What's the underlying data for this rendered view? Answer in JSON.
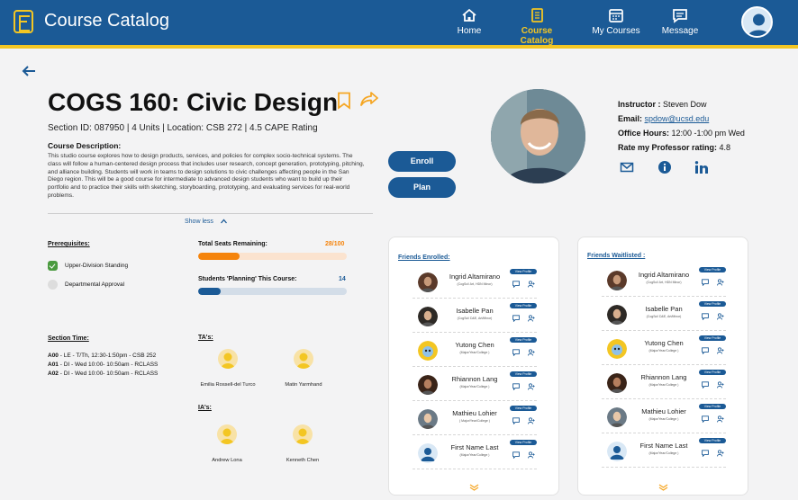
{
  "header": {
    "app_title": "Course Catalog",
    "nav": [
      {
        "label": "Home",
        "icon": "home-icon"
      },
      {
        "label": "Course Catalog",
        "icon": "book-icon",
        "active": true
      },
      {
        "label": "My Courses",
        "icon": "calendar-icon"
      },
      {
        "label": "Message",
        "icon": "message-icon"
      }
    ],
    "colors": {
      "primary": "#1b5a96",
      "accent": "#f3c623",
      "orange": "#f5840c"
    }
  },
  "course": {
    "title": "COGS 160: Civic Design",
    "meta": "Section ID:  087950 | 4 Units | Location: CSB 272 |  4.5 CAPE Rating",
    "description_label": "Course Description:",
    "description": "This studio course explores how to design products, services, and policies for complex socio-technical systems. The class will follow a human-centered design process that includes user research, concept generation, prototyping, pitching, and alliance building. Students will work in teams to design solutions to civic challenges affecting people in the San Diego region. This will be a good course for intermediate to advanced design students who want to build up their portfolio and to practice their skills with sketching, storyboarding, prototyping, and evaluating services for real-world problems.",
    "show_less": "Show less"
  },
  "actions": {
    "enroll": "Enroll",
    "plan": "Plan"
  },
  "instructor": {
    "label": "Instructor :",
    "name": "Steven Dow",
    "email_label": "Email:",
    "email": " spdow@ucsd.edu ",
    "office_label": "Office Hours:",
    "office": "12:00 -1:00 pm Wed",
    "rating_label": "Rate my Professor rating:",
    "rating": "4.8"
  },
  "prerequisites": {
    "label": "Prerequisites:",
    "items": [
      {
        "label": "Upper-Division Standing",
        "met": true
      },
      {
        "label": "Departmental Approval",
        "met": false
      }
    ]
  },
  "seats": {
    "label": "Total Seats Remaining:",
    "count": "28/100",
    "fraction": 0.28,
    "fill_color": "#f5840c",
    "track_color": "#fbe3cf"
  },
  "planning": {
    "label": "Students 'Planning' This Course:",
    "count": "14",
    "fraction": 0.15,
    "fill_color": "#1b5a96",
    "track_color": "#d3dde8"
  },
  "section_time": {
    "label": "Section Time:",
    "rows": [
      {
        "code": "A00",
        "text": " - LE -  T/Th, 12:30-1:50pm - CSB 252"
      },
      {
        "code": "A01",
        "text": " - DI - Wed 10:00- 10:50am - RCLASS"
      },
      {
        "code": "A02",
        "text": " - DI - Wed 10:00- 10:50am - RCLASS"
      }
    ]
  },
  "tas": {
    "label": "TA's:",
    "people": [
      "Emilia Rossell-del Turco",
      "Matin Yarmhand"
    ]
  },
  "ias": {
    "label": "IA's:",
    "people": [
      "Andrew Lona",
      "Kenneth Chen"
    ]
  },
  "friends_enrolled": {
    "title": "Friends Enrolled:",
    "view_label": "View Profile",
    "people": [
      {
        "name": "Ingrid Altamirano",
        "sub": "(CogSci/ Art, HDN Minor)"
      },
      {
        "name": "Isabelle Pan",
        "sub": "(CogSci/ D&E, Art/Minor)"
      },
      {
        "name": "Yutong Chen",
        "sub": "(Major/Year/College )"
      },
      {
        "name": "Rhiannon Lang",
        "sub": "(Major/Year/College )"
      },
      {
        "name": "Mathieu Lohier",
        "sub": "( Major/Year/College )"
      },
      {
        "name": "First Name Last",
        "sub": "(Major/Year/College )"
      }
    ]
  },
  "friends_waitlisted": {
    "title": "Friends Waitlisted :",
    "view_label": "View Profile",
    "people": [
      {
        "name": "Ingrid Altamirano",
        "sub": "(CogSci/ Art, HDN Minor)"
      },
      {
        "name": "Isabelle Pan",
        "sub": "(CogSci/ D&E, Art/Minor)"
      },
      {
        "name": "Yutong Chen",
        "sub": "(Major/Year/College )"
      },
      {
        "name": "Rhiannon Lang",
        "sub": "(Major/Year/College )"
      },
      {
        "name": "Mathieu Lohier",
        "sub": "(Major/Year/College )"
      },
      {
        "name": "First Name Last",
        "sub": "(Major/Year/College )"
      }
    ]
  }
}
